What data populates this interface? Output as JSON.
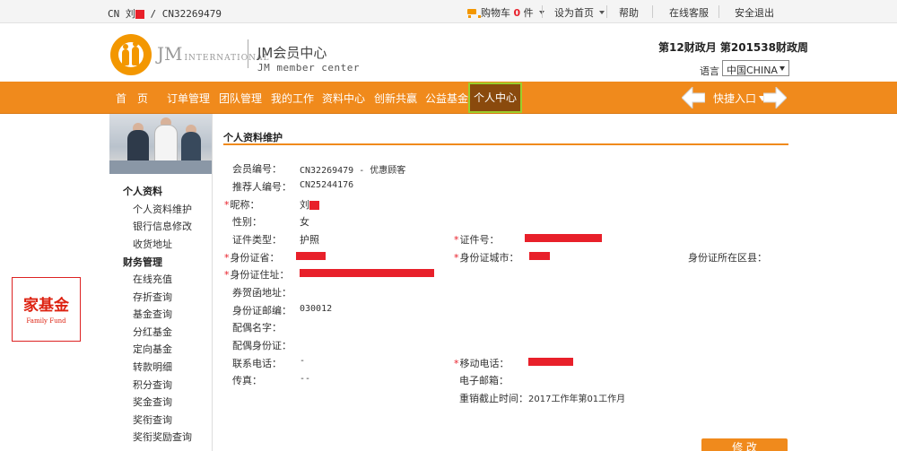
{
  "topbar": {
    "user_prefix": "CN 刘",
    "user_id": "/ CN32269479",
    "cart_label": "购物车",
    "cart_count": "0",
    "cart_unit": "件",
    "homepage_link": "设为首页",
    "help_link": "帮助",
    "support_link": "在线客服",
    "logout_link": "安全退出"
  },
  "header": {
    "brand_jm": "JM",
    "brand_intl": "INTERNATIONAL",
    "center_title": "JM会员中心",
    "center_subtitle": "JM member center",
    "period": "第12财政月  第201538财政周",
    "language_label": "语言",
    "language_value": "中国CHINA"
  },
  "nav": {
    "items": [
      "首　页",
      "订单管理",
      "团队管理",
      "我的工作",
      "资料中心",
      "创新共赢",
      "公益基金"
    ],
    "active": "个人中心",
    "quick_entry": "快捷入口"
  },
  "sidebar": {
    "section1": "个人资料",
    "section1_items": [
      "个人资料维护",
      "银行信息修改",
      "收货地址"
    ],
    "section2": "财务管理",
    "section2_items": [
      "在线充值",
      "存折查询",
      "基金查询",
      "分红基金",
      "定向基金",
      "转款明细",
      "积分查询",
      "奖金查询",
      "奖衔查询",
      "奖衔奖励查询"
    ]
  },
  "badge": {
    "cn": "家基金",
    "en": "Family Fund"
  },
  "form": {
    "title": "个人资料维护",
    "member_no_label": "会员编号：",
    "member_no_value": "CN32269479 - 优惠顾客",
    "referrer_label": "推荐人编号：",
    "referrer_value": "CN25244176",
    "nickname_label": "昵称：",
    "nickname_value": "刘",
    "gender_label": "性别：",
    "gender_value": "女",
    "id_type_label": "证件类型：",
    "id_type_value": "护照",
    "id_no_label": "证件号：",
    "province_label": "身份证省：",
    "city_label": "身份证城市：",
    "district_label": "身份证所在区县：",
    "address_label": "身份证住址：",
    "mail_address_label": "券贺函地址：",
    "postcode_label": "身份证邮编：",
    "postcode_value": "030012",
    "spouse_name_label": "配偶名字：",
    "spouse_id_label": "配偶身份证：",
    "phone_label": "联系电话：",
    "phone_value": "-",
    "mobile_label": "移动电话：",
    "fax_label": "传真：",
    "fax_value": "--",
    "email_label": "电子邮箱：",
    "reregister_label": "重销截止时间：",
    "reregister_value": "2017工作年第01工作月",
    "submit_label": "修 改"
  }
}
